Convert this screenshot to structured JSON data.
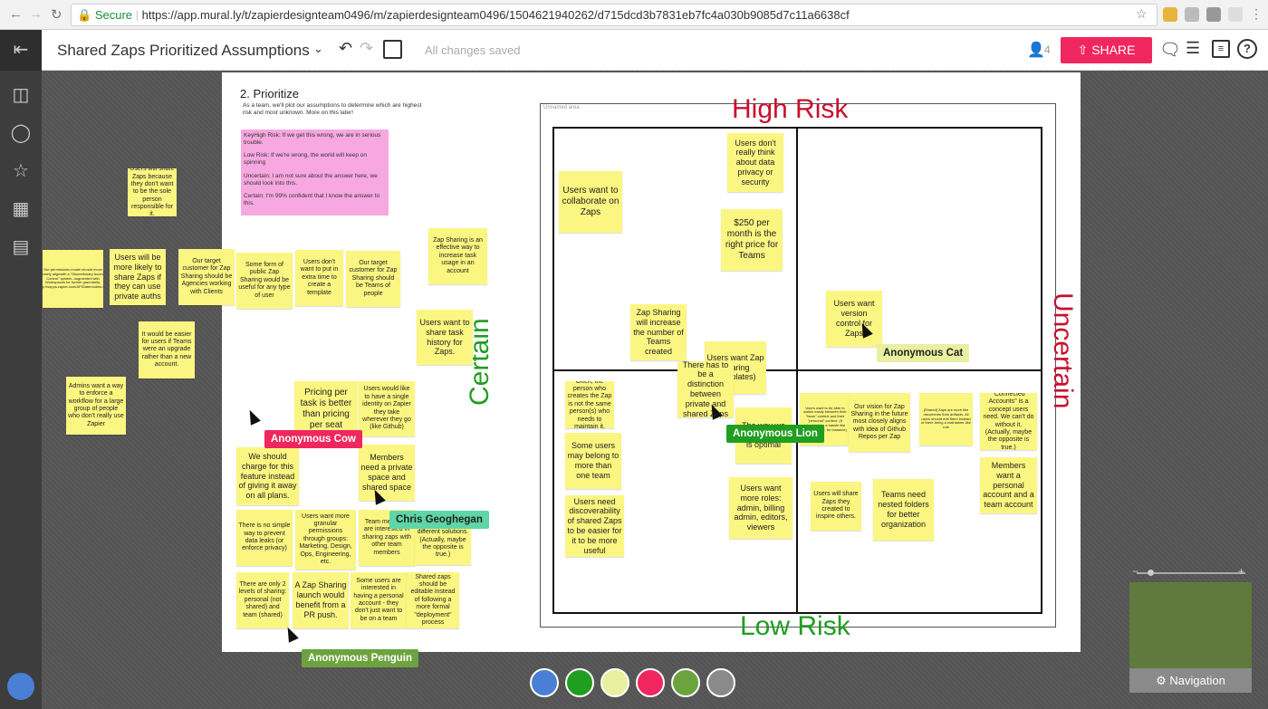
{
  "browser": {
    "secure_label": "Secure",
    "url": "https://app.mural.ly/t/zapierdesignteam0496/m/zapierdesignteam0496/1504621940262/d715dcd3b7831eb7fc4a030b9085d7c11a6638cf"
  },
  "toolbar": {
    "title": "Shared Zaps Prioritized Assumptions",
    "status": "All changes saved",
    "user_count": "4",
    "share_label": "SHARE"
  },
  "board": {
    "heading": "2. Prioritize",
    "intro": "As a team, we'll plot our assumptions to determine which are highest risk and most unknown. More on this later!",
    "key_lines": [
      "KeyHigh Risk: If we get this wrong, we are in serious trouble.",
      "Low Risk: If we're wrong, the world will keep on spinning",
      "Uncertain: I am not sure about the answer here, we should look into this.",
      "Certain: I'm 99% confident that I know the answer to this."
    ],
    "area_label": "Unnamed area",
    "axis_top": "High Risk",
    "axis_bottom": "Low Risk",
    "axis_left": "Certain",
    "axis_right": "Uncertain",
    "colors": {
      "high_risk": "#c8102e",
      "low_risk": "#1f9e1f",
      "sticky": "#fbf681",
      "key": "#f7a8e0"
    }
  },
  "stickies": [
    "Users will share Zaps because they don't want to be the sole person responsible for it.",
    "Our permissions model should move closely alignwith a \"Discretionary Access Control\" system, augmented with Workspaces for further granularity. http://sopps.zapier.com/APIDatemodels.dta",
    "Users will be more likely to share Zaps if they can use private auths",
    "Our target customer for Zap Sharing should be Agencies working with Clients",
    "Some form of public Zap Sharing would be useful for any type of user",
    "Users don't want to put in extra time to create a template",
    "Our target customer for Zap Sharing should be Teams of people",
    "Zap Sharing is an effective way to increase task usage in an account",
    "It would be easier for users if Teams were an upgrade rather than a new account.",
    "Admins want a way to enforce a workflow for a large group of people who don't really use Zapier",
    "Users want to share task history for Zaps.",
    "Pricing per task is better than pricing per seat",
    "Users would like to have a single identity on Zapier they take wherever they go (like Github)",
    "We should charge for this feature instead of giving it away on all plans.",
    "Members need a private space and shared space",
    "There is no simple way to prevent data leaks (or enforce privacy)",
    "Users want more granular permissions through groups: Marketing, Design, Ops, Engineering, etc.",
    "Team members are interested in sharing zaps with other team members",
    "different solutions. (Actually, maybe the opposite is true.)",
    "There are only 2 levels of sharing: personal (not shared) and team (shared)",
    "A Zap Sharing launch would benefit from a PR push.",
    "Some users are interested in having a personal account - they don't just want to be on a team",
    "Shared zaps should be editable instead of following a more formal \"deployment\" process",
    "Users don't really think about data privacy or security",
    "Users want to collaborate on Zaps",
    "$250 per month is the right price for Teams",
    "Zap Sharing will increase the number of Teams created",
    "Users want version control for Zaps",
    "Users want Zap Sharing (templates)",
    "There has to be a distinction between private and shared Zaps",
    "Often, the person who creates the Zap is not the same person(s) who needs to maintain it.",
    "Some users may belong to more than one team",
    "Users need discoverability of shared Zaps to be easier for it to be more useful",
    "The way we ... and Shared is optimal",
    "Users want more roles: admin, billing admin, editors, viewers",
    "Users want to be able to switch easily between their \"team\" context and their \"personal\" context. (It shouldn't be a hassle like Google Drive, for instance)",
    "Our vision for Zap Sharing in the future most closely aligns with idea of Github Repos per Zap",
    "[Shared] Zaps are more like documents than artifacts. All users should edit them instead of there being a maintainer-like role",
    "\"Connected Accounts\" is a concept users need. We can't do without it. (Actually, maybe the opposite is true.)",
    "Members want a personal account and a team account",
    "Users will share Zaps they created to inspire others.",
    "Teams need nested folders for better organization"
  ],
  "collaborators": {
    "cow": "Anonymous Cow",
    "chris": "Chris Geoghegan",
    "lion": "Anonymous Lion",
    "cat": "Anonymous Cat",
    "penguin": "Anonymous Penguin"
  },
  "navigation_label": "Navigation"
}
